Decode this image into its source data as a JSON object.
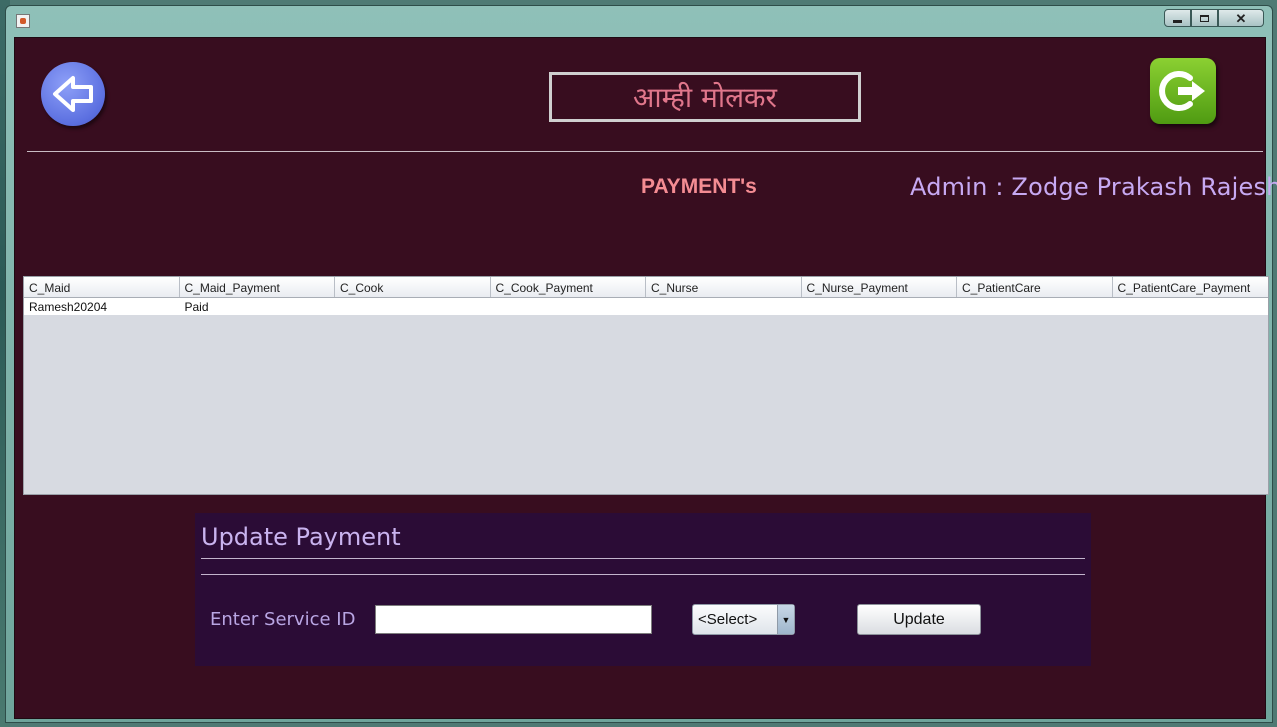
{
  "window": {
    "controls": {
      "minimize_icon": "minimize-icon",
      "maximize_icon": "maximize-icon",
      "close_icon": "close-icon"
    }
  },
  "header": {
    "title": "आम्ही मोलकर",
    "back_icon": "arrow-left-icon",
    "logout_icon": "logout-icon"
  },
  "section": {
    "title": "PAYMENT's",
    "admin_label": "Admin : Zodge Prakash Rajesh"
  },
  "table": {
    "columns": [
      "C_Maid",
      "C_Maid_Payment",
      "C_Cook",
      "C_Cook_Payment",
      "C_Nurse",
      "C_Nurse_Payment",
      "C_PatientCare",
      "C_PatientCare_Payment"
    ],
    "rows": [
      [
        "Ramesh20204",
        "Paid",
        "",
        "",
        "",
        "",
        "",
        ""
      ]
    ]
  },
  "update_panel": {
    "title": "Update Payment",
    "service_id_label": "Enter Service ID",
    "service_id_value": "",
    "select_value": "<Select>",
    "update_button": "Update"
  },
  "colors": {
    "background": "#380d1f",
    "panel": "#2b0c36",
    "title_text": "#e0768b",
    "section_title": "#f48c93",
    "admin_text": "#c7a9f2"
  }
}
